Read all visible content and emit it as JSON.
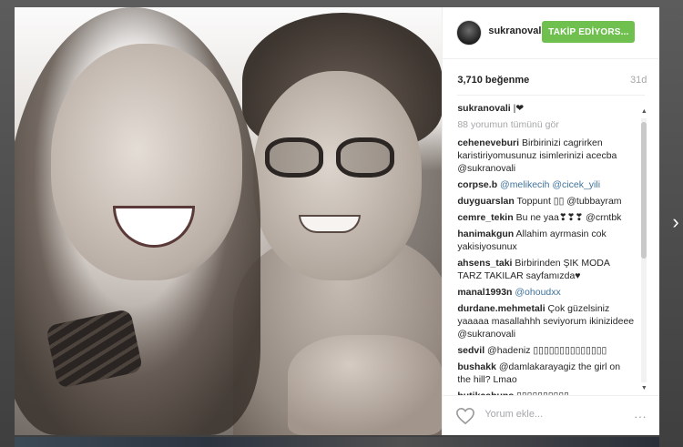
{
  "post": {
    "username": "sukranovali",
    "follow_button": "TAKİP EDİYORS...",
    "likes": "3,710 beğenme",
    "age": "31d",
    "caption": {
      "user": "sukranovali",
      "text": "|❤"
    },
    "view_all": "88 yorumun tümünü gör",
    "comment_placeholder": "Yorum ekle...",
    "more_icon": "..."
  },
  "comments": [
    {
      "user": "ceheneveburi",
      "text": "Birbirinizi cagrirken karistiriyomusunuz isimlerinizi acecba @sukranovali"
    },
    {
      "user": "corpse.b",
      "text": "@melikecih @cicek_yili"
    },
    {
      "user": "duyguarslan",
      "text": "Toppunt ▯▯ @tubbayram"
    },
    {
      "user": "cemre_tekin",
      "text": "Bu ne yaa❣❣❣ @crntbk"
    },
    {
      "user": "hanimakgun",
      "text": "Allahim ayrmasin cok yakisiyosunux"
    },
    {
      "user": "ahsens_taki",
      "text": "Birbirinden ŞIK MODA TARZ TAKILAR sayfamızda♥"
    },
    {
      "user": "manal1993n",
      "text": "@ohoudxx"
    },
    {
      "user": "durdane.mehmetali",
      "text": "Çok güzelsiniz yaaaaa masallahhh seviyorum ikinizideee @sukranovali"
    },
    {
      "user": "sedvil",
      "text": "@hadeniz ▯▯▯▯▯▯▯▯▯▯▯▯▯▯"
    },
    {
      "user": "bushakk",
      "text": "@damlakarayagiz the girl on the hill? Lmao"
    },
    {
      "user": "butikcahuns",
      "text": "▯▯▯▯▯▯▯▯▯▯"
    }
  ],
  "icons": {
    "heart": "heart-icon",
    "next": "chevron-right-icon"
  },
  "colors": {
    "follow": "#70c050",
    "link": "#3f729b",
    "muted": "#a5a7aa"
  }
}
